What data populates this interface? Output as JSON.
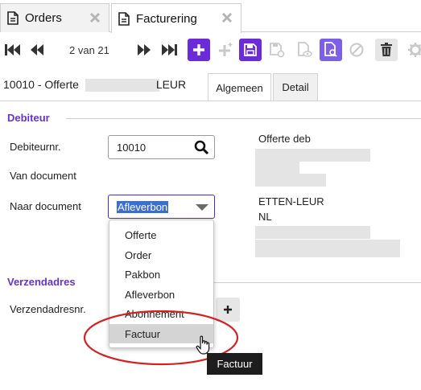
{
  "tabs": [
    {
      "label": "Orders",
      "icon": "document-icon",
      "active": false
    },
    {
      "label": "Facturering",
      "icon": "document-icon",
      "active": true
    }
  ],
  "toolbar": {
    "pager_text": "2 van 21",
    "accent": "#6c2bd9"
  },
  "header": {
    "doc_prefix": "10010 - Offerte",
    "doc_suffix": "LEUR",
    "subtabs": [
      "Algemeen",
      "Detail"
    ]
  },
  "debiteur": {
    "title": "Debiteur",
    "debiteurnr_label": "Debiteurnr.",
    "debiteurnr_value": "10010",
    "van_document_label": "Van document",
    "naar_document_label": "Naar document",
    "naar_document_value": "Afleverbon",
    "address_title": "Offerte deb",
    "address_city": "ETTEN-LEUR",
    "address_country": "NL"
  },
  "dropdown_options": [
    "Offerte",
    "Order",
    "Pakbon",
    "Afleverbon",
    "Abonnement",
    "Factuur"
  ],
  "verzendadres": {
    "title": "Verzendadres",
    "verzendadresnr_label": "Verzendadresnr."
  },
  "tooltip": "Factuur"
}
